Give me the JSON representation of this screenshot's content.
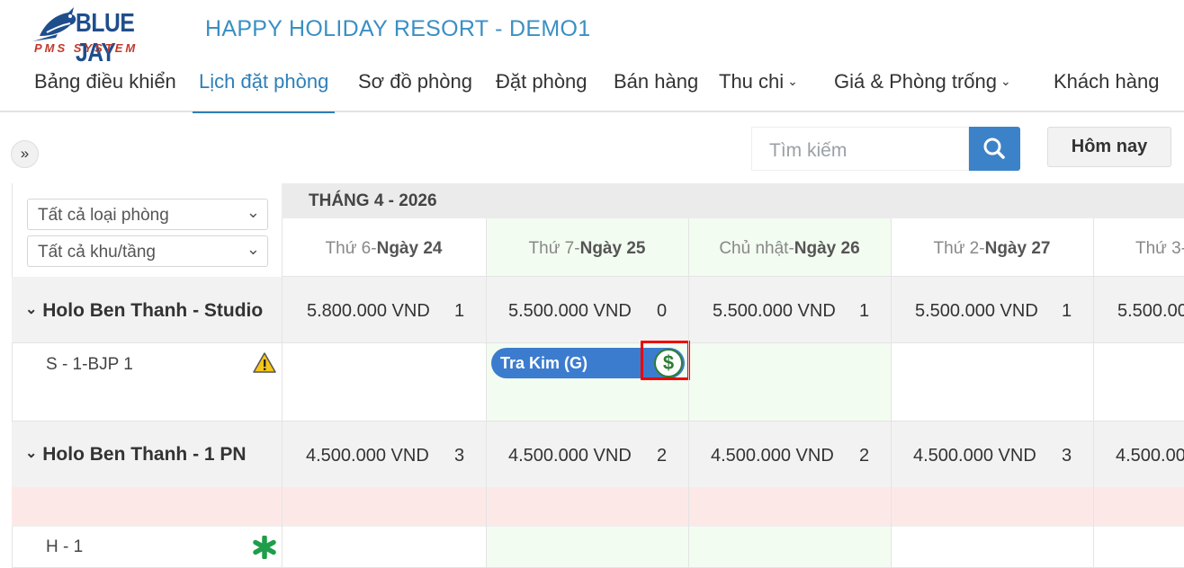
{
  "brand": {
    "name": "BLUE JAY",
    "sub": "PMS SYSTEM"
  },
  "app_title": "HAPPY HOLIDAY RESORT - DEMO1",
  "nav": [
    {
      "label": "Bảng điều khiển",
      "active": false
    },
    {
      "label": "Lịch đặt phòng",
      "active": true
    },
    {
      "label": "Sơ đồ phòng",
      "active": false
    },
    {
      "label": "Đặt phòng",
      "active": false
    },
    {
      "label": "Bán hàng",
      "active": false
    },
    {
      "label": "Thu chi",
      "active": false,
      "dropdown": true
    },
    {
      "label": "Giá & Phòng trống",
      "active": false,
      "dropdown": true
    },
    {
      "label": "Khách hàng",
      "active": false
    }
  ],
  "toolbar": {
    "search_placeholder": "Tìm kiếm",
    "today_label": "Hôm nay",
    "toggle_icon": "double-chevron-right-icon"
  },
  "filters": {
    "room_type": "Tất cả loại phòng",
    "area_floor": "Tất cả khu/tầng"
  },
  "calendar": {
    "month_label": "THÁNG 4 - 2026",
    "days": [
      {
        "weekday": "Thứ 6-",
        "day": "Ngày 24"
      },
      {
        "weekday": "Thứ 7-",
        "day": "Ngày 25"
      },
      {
        "weekday": "Chủ nhật-",
        "day": "Ngày 26"
      },
      {
        "weekday": "Thứ 2-",
        "day": "Ngày 27"
      },
      {
        "weekday": "Thứ 3-",
        "day": ""
      }
    ],
    "groups": [
      {
        "name": "Holo Ben Thanh - Studio",
        "cells": [
          {
            "price": "5.800.000 VND",
            "count": "1"
          },
          {
            "price": "5.500.000 VND",
            "count": "0"
          },
          {
            "price": "5.500.000 VND",
            "count": "1"
          },
          {
            "price": "5.500.000 VND",
            "count": "1"
          },
          {
            "price": "5.500.00",
            "count": ""
          }
        ],
        "rooms": [
          {
            "name": "S - 1-BJP 1",
            "status_icon": "warning-icon"
          }
        ]
      },
      {
        "name": "Holo Ben Thanh - 1 PN",
        "cells": [
          {
            "price": "4.500.000 VND",
            "count": "3"
          },
          {
            "price": "4.500.000 VND",
            "count": "2"
          },
          {
            "price": "4.500.000 VND",
            "count": "2"
          },
          {
            "price": "4.500.000 VND",
            "count": "3"
          },
          {
            "price": "4.500.00",
            "count": ""
          }
        ],
        "rooms": [
          {
            "name": "H - 1",
            "status_icon": "asterisk-icon"
          }
        ]
      }
    ],
    "booking": {
      "guest": "Tra Kim (G)",
      "icon": "dollar-icon"
    }
  },
  "colors": {
    "accent": "#3c82c9",
    "title": "#3a8fc4",
    "weekend": "#f3fcf1",
    "highlight": "#e00000"
  }
}
